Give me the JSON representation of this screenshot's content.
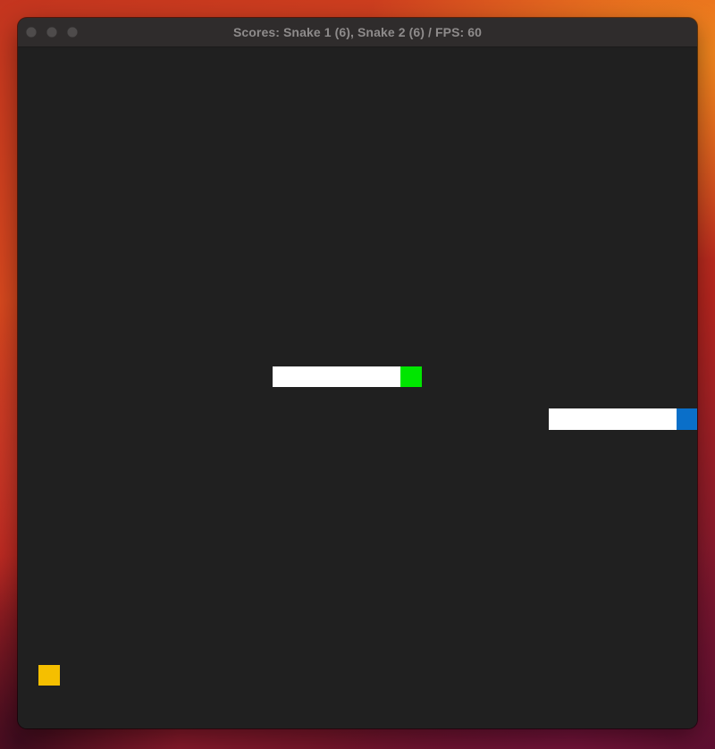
{
  "window": {
    "title": "Scores: Snake 1 (6), Snake 2 (6) / FPS: 60",
    "traffic_lights": [
      "close",
      "minimize",
      "maximize"
    ]
  },
  "game": {
    "background_color": "#202020",
    "grid_cell_units": 1,
    "snake1": {
      "name": "Snake 1",
      "score": 6,
      "body_color": "#ffffff",
      "head_color": "#00e600",
      "direction": "right"
    },
    "snake2": {
      "name": "Snake 2",
      "score": 6,
      "body_color": "#ffffff",
      "head_color": "#0a6fc9",
      "direction": "right"
    },
    "food": {
      "color": "#f5bf00"
    },
    "fps": 60
  }
}
